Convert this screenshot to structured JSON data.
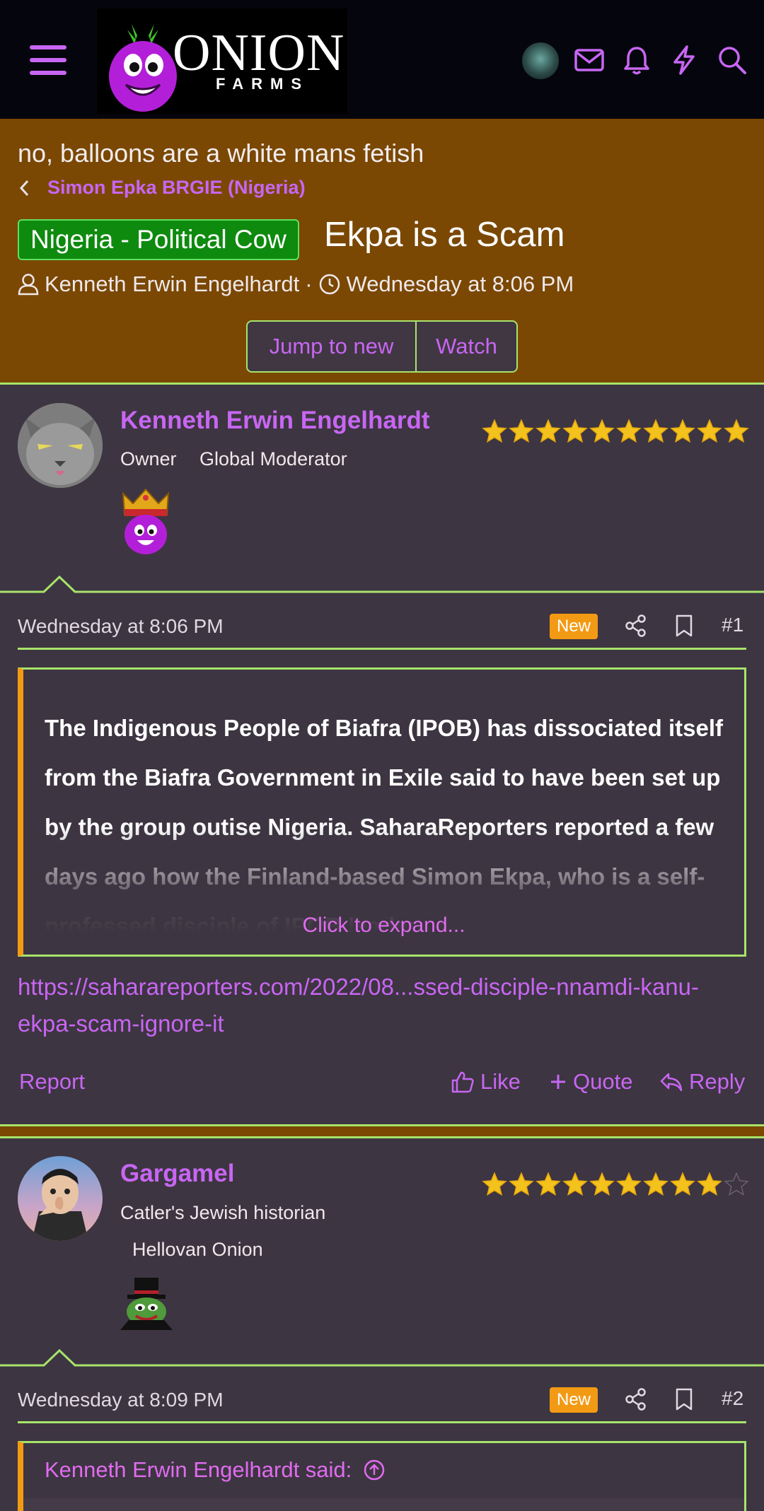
{
  "header": {
    "logo_word": "ONION",
    "logo_sub": "FARMS",
    "icons": [
      "menu-icon",
      "avatar",
      "envelope-icon",
      "bell-icon",
      "bolt-icon",
      "search-icon"
    ]
  },
  "thread": {
    "tagline": "no, balloons are a white mans fetish",
    "breadcrumb": "Simon Epka BRGIE (Nigeria)",
    "prefix": "Nigeria - Political Cow",
    "title": "Ekpa is a Scam",
    "author": "Kenneth Erwin Engelhardt",
    "separator": "·",
    "date": "Wednesday at 8:06 PM",
    "buttons": {
      "jump": "Jump to new",
      "watch": "Watch"
    }
  },
  "posts": [
    {
      "username": "Kenneth Erwin Engelhardt",
      "titles": [
        "Owner",
        "Global Moderator"
      ],
      "stars_filled": 10,
      "stars_total": 10,
      "date": "Wednesday at 8:06 PM",
      "badge": "New",
      "number": "#1",
      "quote": "The Indigenous People of Biafra (IPOB) has dissociated itself from the Biafra Government in Exile said to have been set up by the group outise Nigeria. SaharaReporters reported a few days ago how the Finland-based Simon Ekpa, who is a self-professed disciple of IPOB leader",
      "expand": "Click to expand...",
      "link": "https://saharareporters.com/2022/08...ssed-disciple-nnamdi-kanu-ekpa-scam-ignore-it",
      "actions": {
        "report": "Report",
        "like": "Like",
        "quote": "Quote",
        "reply": "Reply"
      }
    },
    {
      "username": "Gargamel",
      "titles": [
        "Catler's Jewish historian",
        "Hellovan Onion"
      ],
      "stars_filled": 9,
      "stars_total": 10,
      "date": "Wednesday at 8:09 PM",
      "badge": "New",
      "number": "#2",
      "quote_head": "Kenneth Erwin Engelhardt said:"
    }
  ],
  "colors": {
    "accent": "#c866f3",
    "header_bg": "#05060d",
    "thread_bg": "#7a4803",
    "body_bg": "#3d3541",
    "line": "#a7e36a",
    "badge": "#f39a14",
    "prefix_bg": "#0e8a0e"
  }
}
